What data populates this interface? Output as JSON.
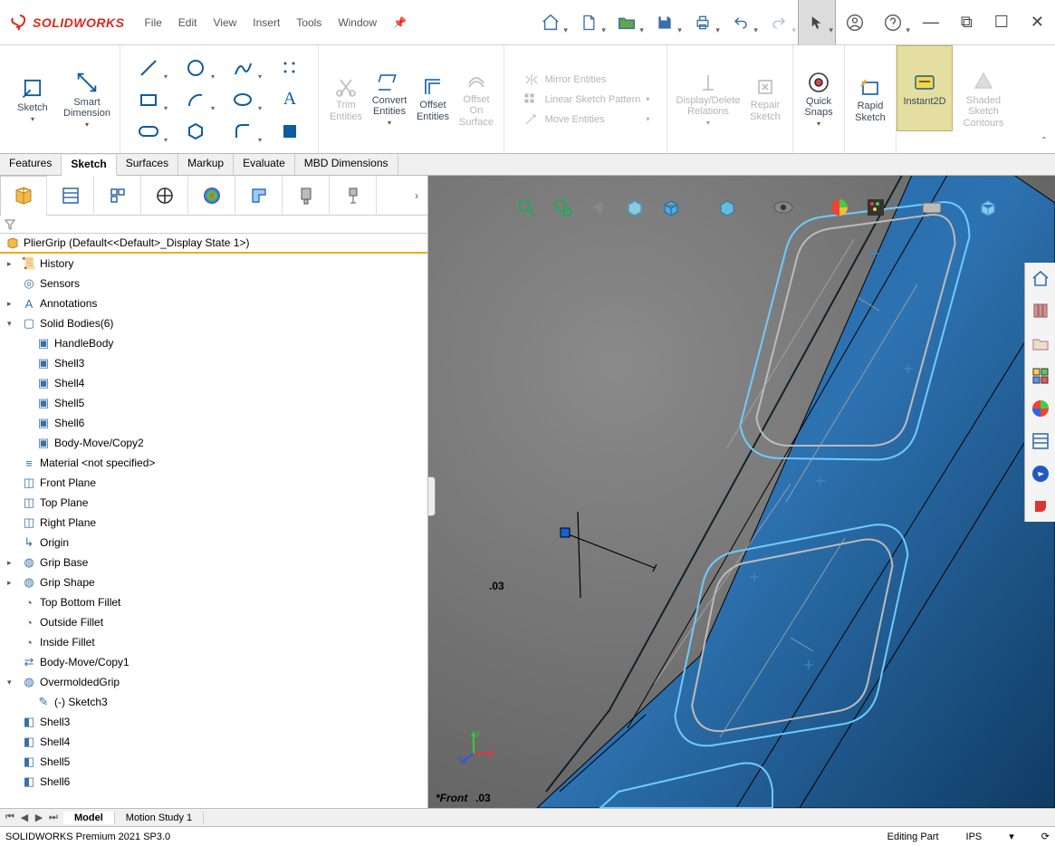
{
  "app": {
    "logo_text_1": "SOLID",
    "logo_text_2": "WORKS"
  },
  "menu": [
    "File",
    "Edit",
    "View",
    "Insert",
    "Tools",
    "Window"
  ],
  "ribbon": {
    "sketch": "Sketch",
    "smart_dimension": "Smart\nDimension",
    "trim_entities": "Trim\nEntities",
    "convert_entities": "Convert\nEntities",
    "offset_entities": "Offset\nEntities",
    "offset_on_surface": "Offset\nOn\nSurface",
    "mirror_entities": "Mirror Entities",
    "linear_sketch_pattern": "Linear Sketch Pattern",
    "move_entities": "Move Entities",
    "display_delete_relations": "Display/Delete\nRelations",
    "repair_sketch": "Repair\nSketch",
    "quick_snaps": "Quick\nSnaps",
    "rapid_sketch": "Rapid\nSketch",
    "instant2d": "Instant2D",
    "shaded_sketch_contours": "Shaded\nSketch\nContours"
  },
  "cmd_tabs": [
    "Features",
    "Sketch",
    "Surfaces",
    "Markup",
    "Evaluate",
    "MBD Dimensions"
  ],
  "cmd_tab_active": 1,
  "feature_tree": {
    "root": "PlierGrip  (Default<<Default>_Display State 1>)",
    "items": [
      {
        "t": "History",
        "icon": "📜",
        "tw": "▸",
        "ind": 0
      },
      {
        "t": "Sensors",
        "icon": "◎",
        "ind": 0
      },
      {
        "t": "Annotations",
        "icon": "A",
        "tw": "▸",
        "ind": 0
      },
      {
        "t": "Solid Bodies(6)",
        "icon": "▢",
        "tw": "▾",
        "ind": 0
      },
      {
        "t": "HandleBody",
        "icon": "▣",
        "ind": 1
      },
      {
        "t": "Shell3",
        "icon": "▣",
        "ind": 1
      },
      {
        "t": "Shell4",
        "icon": "▣",
        "ind": 1
      },
      {
        "t": "Shell5",
        "icon": "▣",
        "ind": 1
      },
      {
        "t": "Shell6",
        "icon": "▣",
        "ind": 1
      },
      {
        "t": "Body-Move/Copy2",
        "icon": "▣",
        "ind": 1
      },
      {
        "t": "Material <not specified>",
        "icon": "≡",
        "ind": 0
      },
      {
        "t": "Front Plane",
        "icon": "◫",
        "ind": 0
      },
      {
        "t": "Top Plane",
        "icon": "◫",
        "ind": 0
      },
      {
        "t": "Right Plane",
        "icon": "◫",
        "ind": 0
      },
      {
        "t": "Origin",
        "icon": "↳",
        "ind": 0
      },
      {
        "t": "Grip Base",
        "icon": "◍",
        "tw": "▸",
        "ind": 0
      },
      {
        "t": "Grip Shape",
        "icon": "◍",
        "tw": "▸",
        "ind": 0
      },
      {
        "t": "Top Bottom Fillet",
        "icon": "◔",
        "ind": 0
      },
      {
        "t": "Outside Fillet",
        "icon": "◔",
        "ind": 0
      },
      {
        "t": "Inside Fillet",
        "icon": "◔",
        "ind": 0
      },
      {
        "t": "Body-Move/Copy1",
        "icon": "⇄",
        "ind": 0
      },
      {
        "t": "OvermoldedGrip",
        "icon": "◍",
        "tw": "▾",
        "ind": 0
      },
      {
        "t": "(-) Sketch3",
        "icon": "✎",
        "ind": 1
      },
      {
        "t": "Shell3",
        "icon": "◧",
        "ind": 0
      },
      {
        "t": "Shell4",
        "icon": "◧",
        "ind": 0
      },
      {
        "t": "Shell5",
        "icon": "◧",
        "ind": 0
      },
      {
        "t": "Shell6",
        "icon": "◧",
        "ind": 0
      }
    ]
  },
  "bottom_tabs": [
    "Model",
    "Motion Study 1"
  ],
  "status_bar": {
    "left": "SOLIDWORKS Premium 2021 SP3.0",
    "mode": "Editing Part",
    "units": "IPS"
  },
  "gfx": {
    "dim1": ".03",
    "dim2": ".03",
    "front_label": "*Front"
  }
}
